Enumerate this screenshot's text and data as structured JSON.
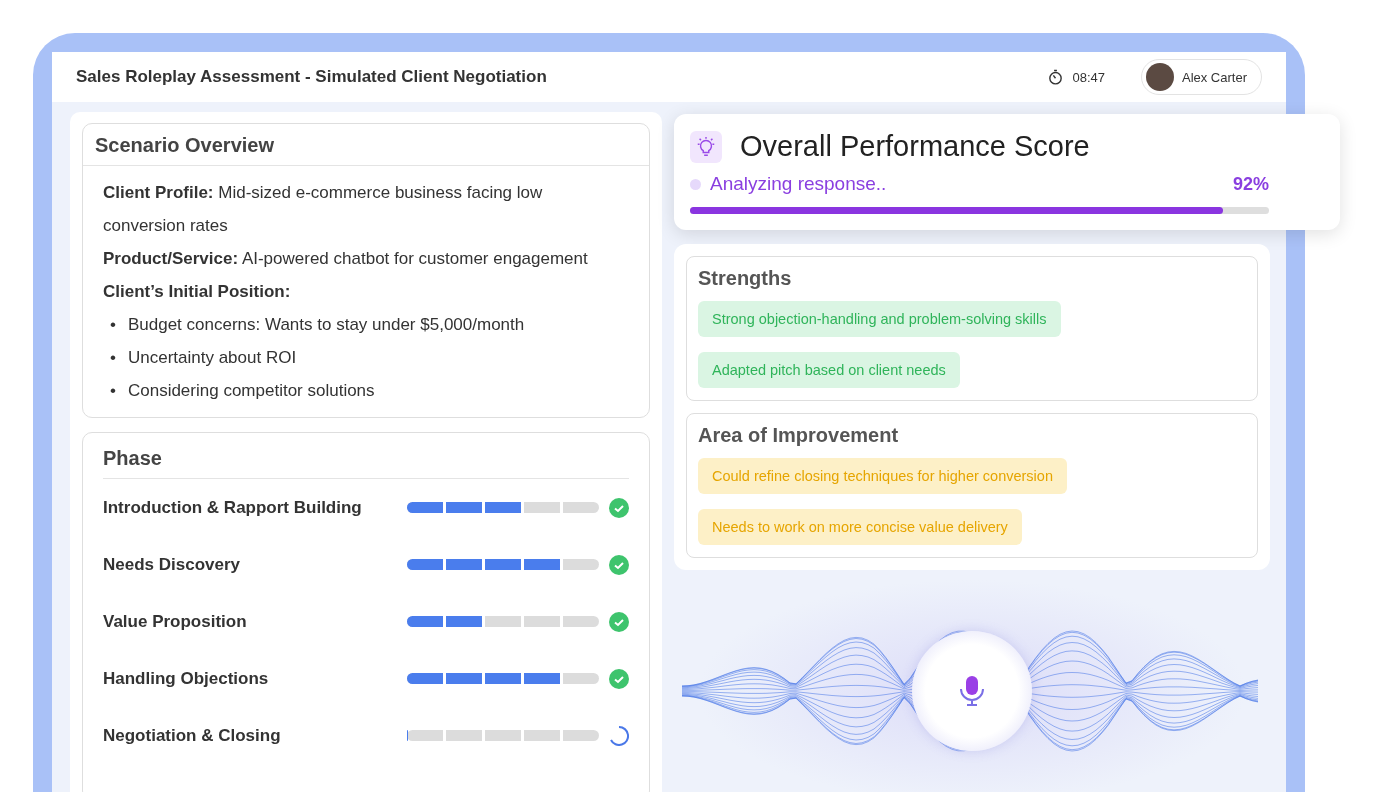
{
  "header": {
    "title": "Sales Roleplay Assessment - Simulated Client Negotiation",
    "timer": "08:47",
    "user": {
      "name": "Alex Carter"
    }
  },
  "scenario": {
    "title": "Scenario Overview",
    "fields": [
      {
        "label": "Client Profile:",
        "value": "Mid-sized e-commerce business facing low conversion rates"
      },
      {
        "label": "Product/Service:",
        "value": "AI-powered chatbot for customer engagement"
      },
      {
        "label": "Client’s Initial Position:"
      }
    ],
    "bullets": [
      {
        "marker": "•",
        "text": "Budget concerns: Wants to stay under $5,000/month"
      },
      {
        "marker": "•",
        "text": "Uncertainty about ROI"
      },
      {
        "marker": "•",
        "text": "Considering competitor solutions"
      }
    ]
  },
  "phase": {
    "title": "Phase",
    "items": [
      {
        "name": "Introduction & Rapport Building",
        "level": 0.6,
        "completed": true
      },
      {
        "name": "Needs Discovery",
        "level": 0.8,
        "completed": true
      },
      {
        "name": "Value Proposition",
        "level": 0.4,
        "completed": true
      },
      {
        "name": "Handling Objections",
        "level": 0.8,
        "completed": true
      },
      {
        "name": "Negotiation & Closing",
        "level": 0,
        "completed": false
      }
    ]
  },
  "score": {
    "title": "Overall Performance Score",
    "status": "Analyzing response..",
    "value": "92%",
    "level": 0.92
  },
  "feedback": [
    {
      "title": "Strengths",
      "kind": "positive",
      "items": [
        "Strong objection-handling and problem-solving skills",
        "Adapted pitch based on client needs"
      ]
    },
    {
      "title": "Area of Improvement",
      "kind": "warning",
      "items": [
        "Could refine closing techniques for higher conversion",
        "Needs to work on more concise value delivery"
      ]
    }
  ]
}
